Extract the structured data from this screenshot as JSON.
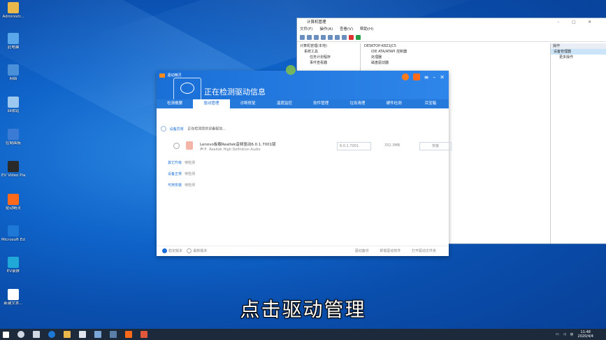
{
  "desktop": {
    "icons": [
      {
        "label": "Administr...",
        "icon": "user-folder-icon",
        "color": "#e8b84a"
      },
      {
        "label": "此电脑",
        "icon": "this-pc-icon",
        "color": "#5aa8ea"
      },
      {
        "label": "网络",
        "icon": "network-icon",
        "color": "#4a90d9"
      },
      {
        "label": "回收站",
        "icon": "recycle-bin-icon",
        "color": "#9cc7ee"
      },
      {
        "label": "控制面板",
        "icon": "control-panel-icon",
        "color": "#3a7bd5"
      },
      {
        "label": "EV Video Player",
        "icon": "ev-player-icon",
        "color": "#2a2a2a"
      },
      {
        "label": "驱动精灵",
        "icon": "driver-wizard-icon",
        "color": "#ff6a1a"
      },
      {
        "label": "Microsoft Edge",
        "icon": "edge-icon",
        "color": "#1e78d6"
      },
      {
        "label": "EV录屏",
        "icon": "ev-recorder-icon",
        "color": "#20a8d8"
      },
      {
        "label": "新建文本...",
        "icon": "text-file-icon",
        "color": "#ffffff"
      }
    ]
  },
  "computer_management": {
    "title": "计算机管理",
    "menu": [
      "文件(F)",
      "操作(A)",
      "查看(V)",
      "帮助(H)"
    ],
    "tree": [
      {
        "label": "计算机管理(本地)",
        "selected": false
      },
      {
        "label": "系统工具",
        "selected": false
      },
      {
        "label": "任务计划程序",
        "selected": false
      },
      {
        "label": "事件查看器",
        "selected": false
      }
    ],
    "devices": [
      {
        "label": "DESKTOP-K8Z1JC5"
      },
      {
        "label": "IDE ATA/ATAPI 控制器"
      },
      {
        "label": "处理器"
      },
      {
        "label": "磁盘驱动器"
      }
    ],
    "operations_header": "操作",
    "operations": [
      {
        "label": "设备管理器",
        "selected": true
      },
      {
        "label": "更多操作",
        "selected": false
      }
    ]
  },
  "driver_app": {
    "brand": "驱动精灵",
    "heading": "正在检测驱动信息",
    "tabs": [
      {
        "label": "检测概要",
        "active": false
      },
      {
        "label": "驱动管理",
        "active": true
      },
      {
        "label": "诊断修复",
        "active": false
      },
      {
        "label": "温度监控",
        "active": false
      },
      {
        "label": "软件管理",
        "active": false
      },
      {
        "label": "垃圾清理",
        "active": false
      },
      {
        "label": "硬件检测",
        "active": false
      },
      {
        "label": "百宝箱",
        "active": false
      }
    ],
    "scan_key": "设备异常",
    "scan_text": "正在检测您的设备驱动...",
    "driver": {
      "name": "Lenovo板载Realtek音频驱动6.0.1.7001版",
      "subtitle_key": "声卡",
      "subtitle": "Realtek High Definition Audio",
      "version": "6.0.1.7001",
      "size": "332.3MB",
      "install_label": "安装"
    },
    "sections": [
      {
        "key": "其它升级",
        "status": "待检测"
      },
      {
        "key": "设备正常",
        "status": "待检测"
      },
      {
        "key": "可用安装",
        "status": "待检测"
      }
    ],
    "footer": {
      "option_a": "稳定版本",
      "option_b": "最新版本",
      "links": [
        "驱动备份",
        "卸载驱动软件",
        "打开驱动文件夹"
      ]
    }
  },
  "subtitle": "点击驱动管理",
  "taskbar": {
    "time": "11:48",
    "date": "2020/4/4",
    "ime": "中"
  }
}
